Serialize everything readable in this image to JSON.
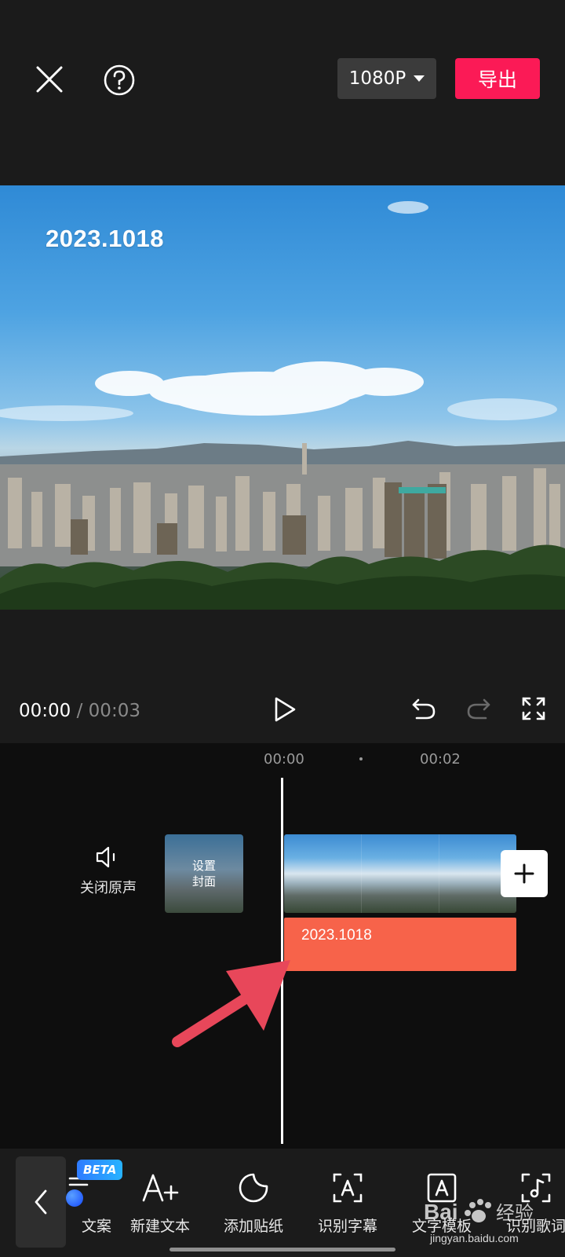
{
  "header": {
    "resolution": "1080P",
    "export_label": "导出"
  },
  "preview": {
    "overlay_text": "2023.1018"
  },
  "playback": {
    "current_time": "00:00",
    "separator": "/",
    "total_time": "00:03"
  },
  "timeline": {
    "ruler": [
      "00:00",
      "00:02"
    ],
    "mute_label": "关闭原声",
    "cover_label": "设置封面",
    "text_clip_label": "2023.1018",
    "frame_count": 3
  },
  "toolbar": {
    "beta_badge": "BETA",
    "items": [
      {
        "label": "文案",
        "icon": "copywriting-icon"
      },
      {
        "label": "新建文本",
        "icon": "new-text-icon"
      },
      {
        "label": "添加贴纸",
        "icon": "sticker-icon"
      },
      {
        "label": "识别字幕",
        "icon": "recognize-subtitles-icon"
      },
      {
        "label": "文字模板",
        "icon": "text-template-icon"
      },
      {
        "label": "识别歌词",
        "icon": "recognize-lyrics-icon"
      }
    ]
  },
  "watermark": {
    "text": "Bai经验",
    "url": "jingyan.baidu.com"
  },
  "colors": {
    "accent": "#fb1a56",
    "text_clip": "#f7634a",
    "background": "#1b1b1b",
    "timeline_bg": "#0e0e0e",
    "arrow": "#e8475a"
  }
}
